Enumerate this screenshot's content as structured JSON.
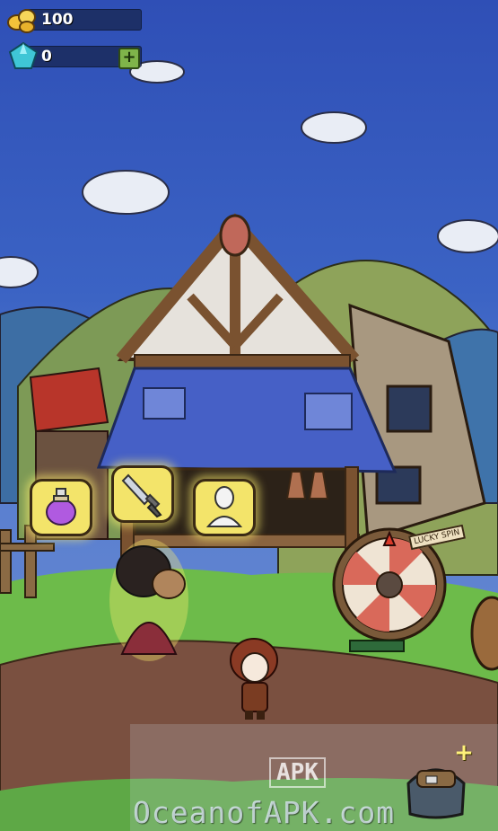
{
  "hud": {
    "gold_value": "100",
    "gems_value": "0",
    "add_gems_label": "+"
  },
  "shop": {
    "items": [
      {
        "name": "potion",
        "icon": "potion-icon"
      },
      {
        "name": "weapon",
        "icon": "sword-icon"
      },
      {
        "name": "armor",
        "icon": "armor-bust-icon"
      }
    ]
  },
  "wheel": {
    "sign_text": "LUCKY SPIN"
  },
  "inventory": {
    "add_label": "+"
  },
  "watermark": {
    "text": "OceanofAPK.com",
    "badge_text": "APK"
  },
  "colors": {
    "sky": "#3b63c4",
    "grass": "#6dbb4a",
    "path": "#7a5040",
    "roof": "#4660c6",
    "bubble": "#f3e46a"
  }
}
